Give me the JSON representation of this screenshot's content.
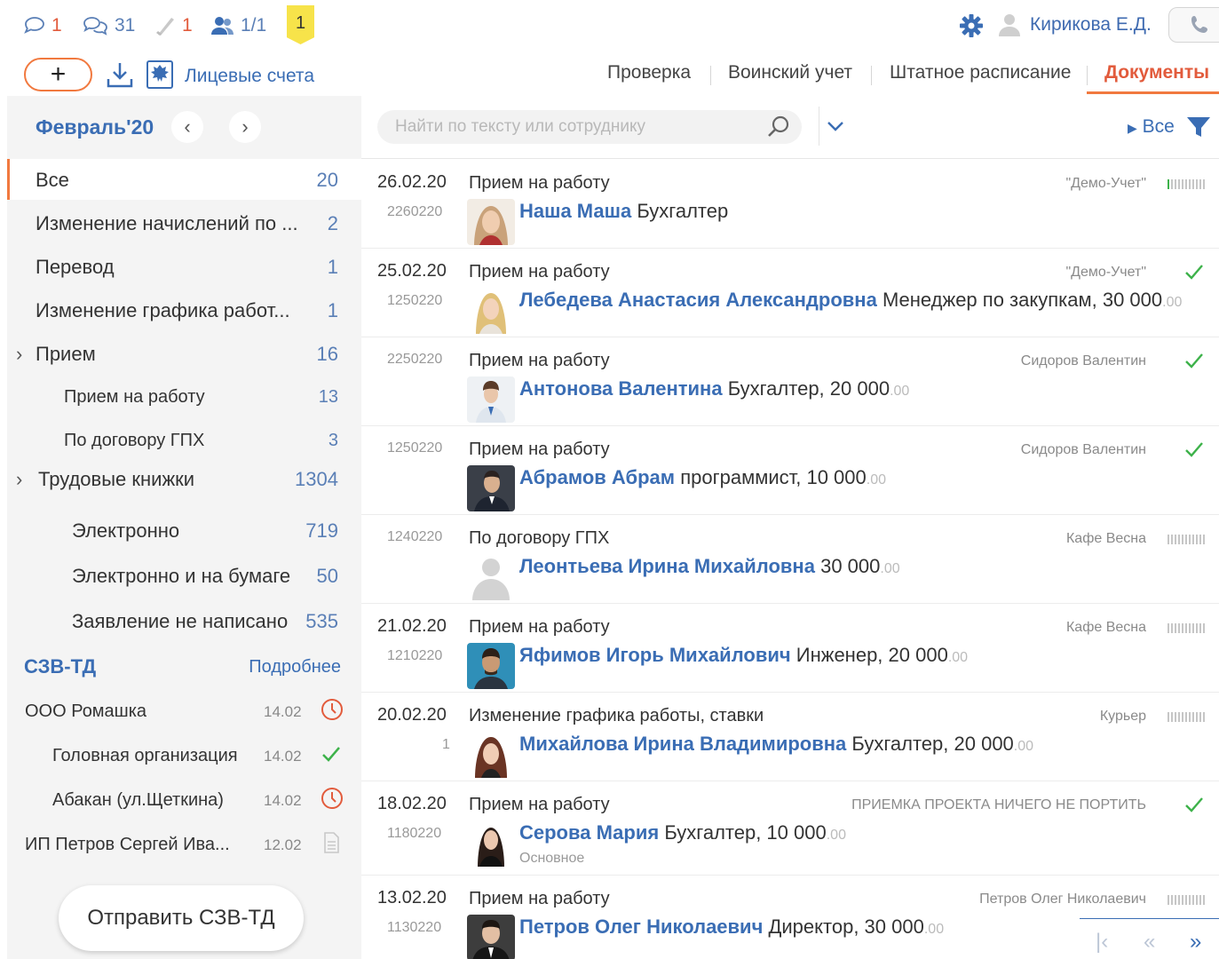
{
  "topbar": {
    "counters": [
      {
        "icon": "comment-icon",
        "value": "1",
        "color": "#e25b3c"
      },
      {
        "icon": "chat-icon",
        "value": "31",
        "color": "#5a7fb6"
      },
      {
        "icon": "phone-icon",
        "value": "1",
        "color": "#e25b3c"
      },
      {
        "icon": "users-icon",
        "value": "1/1",
        "color": "#5a7fb6"
      }
    ],
    "badge": "1",
    "user_name": "Кирикова Е.Д."
  },
  "toolbar": {
    "add_label": "+",
    "accounts_label": "Лицевые счета"
  },
  "tabs": [
    {
      "label": "Проверка",
      "active": false
    },
    {
      "label": "Воинский учет",
      "active": false
    },
    {
      "label": "Штатное расписание",
      "active": false
    },
    {
      "label": "Документы",
      "active": true
    }
  ],
  "sidebar": {
    "period": "Февраль'20",
    "categories": [
      {
        "label": "Все",
        "count": "20",
        "active": true
      },
      {
        "label": "Изменение начислений по ...",
        "count": "2"
      },
      {
        "label": "Перевод",
        "count": "1"
      },
      {
        "label": "Изменение графика работ...",
        "count": "1"
      },
      {
        "label": "Прием",
        "count": "16",
        "expandable": true
      },
      {
        "label": "Прием на работу",
        "count": "13"
      },
      {
        "label": "По договору ГПХ",
        "count": "3"
      },
      {
        "label": "Трудовые книжки",
        "count": "1304",
        "expandable": true
      },
      {
        "label": "Электронно",
        "count": "719"
      },
      {
        "label": "Электронно и на бумаге",
        "count": "50"
      },
      {
        "label": "Заявление не написано",
        "count": "535"
      }
    ],
    "szv": {
      "title": "СЗВ-ТД",
      "more": "Подробнее",
      "orgs": [
        {
          "label": "ООО Ромашка",
          "date": "14.02",
          "status": "clock-icon"
        },
        {
          "label": "Головная организация",
          "date": "14.02",
          "status": "check-icon"
        },
        {
          "label": "Абакан (ул.Щеткина)",
          "date": "14.02",
          "status": "clock-icon"
        },
        {
          "label": "ИП Петров Сергей Ива...",
          "date": "12.02",
          "status": "document-icon"
        }
      ]
    },
    "send_button": "Отправить СЗВ-ТД"
  },
  "search": {
    "placeholder": "Найти по тексту или сотруднику",
    "filter_label": "Все"
  },
  "documents": [
    {
      "date": "26.02.20",
      "num": "2260220",
      "type": "Прием на работу",
      "org": "\"Демо-Учет\"",
      "name": "Наша Маша",
      "position": "Бухгалтер",
      "kop": "",
      "status": "bars-green"
    },
    {
      "date": "25.02.20",
      "num": "1250220",
      "type": "Прием на работу",
      "org": "\"Демо-Учет\"",
      "name": "Лебедева Анастасия Александровна",
      "position": "Менеджер по закупкам, 30 000",
      "kop": ".00",
      "status": "check"
    },
    {
      "date": "",
      "num": "2250220",
      "type": "Прием на работу",
      "org": "Сидоров Валентин",
      "name": "Антонова Валентина",
      "position": "Бухгалтер, 20 000",
      "kop": ".00",
      "status": "check"
    },
    {
      "date": "",
      "num": "1250220",
      "type": "Прием на работу",
      "org": "Сидоров Валентин",
      "name": "Абрамов Абрам",
      "position": "программист, 10 000",
      "kop": ".00",
      "status": "check"
    },
    {
      "date": "",
      "num": "1240220",
      "type": "По договору ГПХ",
      "org": "Кафе Весна",
      "name": "Леонтьева Ирина Михайловна",
      "position": "30 000",
      "kop": ".00",
      "status": "bars"
    },
    {
      "date": "21.02.20",
      "num": "1210220",
      "type": "Прием на работу",
      "org": "Кафе Весна",
      "name": "Яфимов Игорь Михайлович",
      "position": "Инженер, 20 000",
      "kop": ".00",
      "status": "bars"
    },
    {
      "date": "20.02.20",
      "num": "1",
      "type": "Изменение графика работы, ставки",
      "org": "Курьер",
      "name": "Михайлова Ирина Владимировна",
      "position": "Бухгалтер, 20 000",
      "kop": ".00",
      "status": "bars"
    },
    {
      "date": "18.02.20",
      "num": "1180220",
      "type": "Прием на работу",
      "org": "ПРИЕМКА ПРОЕКТА НИЧЕГО НЕ ПОРТИТЬ",
      "name": "Серова Мария",
      "position": "Бухгалтер, 10 000",
      "kop": ".00",
      "status": "check",
      "sub": "Основное"
    },
    {
      "date": "13.02.20",
      "num": "1130220",
      "type": "Прием на работу",
      "org": "Петров Олег Николаевич",
      "name": "Петров Олег Николаевич",
      "position": "Директор, 30 000",
      "kop": ".00",
      "status": "bars"
    }
  ],
  "pager": {
    "first": "|‹",
    "prev": "«",
    "next": "»"
  }
}
